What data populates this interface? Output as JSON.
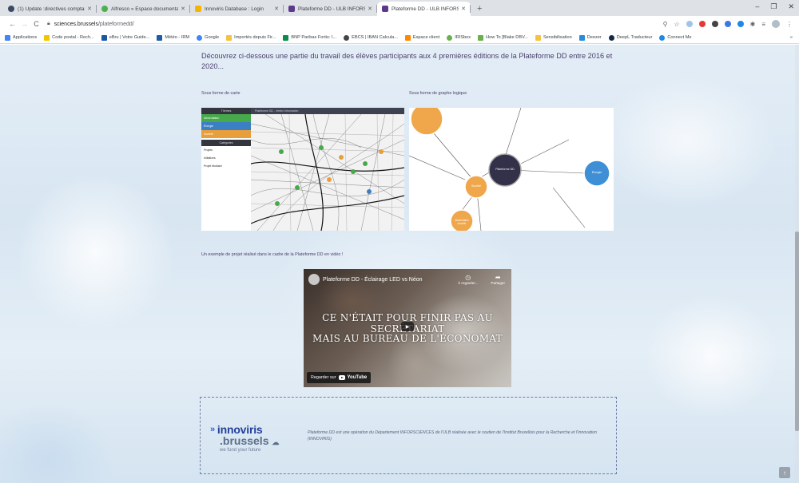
{
  "browser": {
    "tabs": [
      {
        "title": "(1) Update :directives comptables",
        "icon_color": "#3b4a63"
      },
      {
        "title": "Alfresco » Espace documentaire",
        "icon_color": "#4caf50"
      },
      {
        "title": "Innoviris Database : Login",
        "icon_color": "#f5b400"
      },
      {
        "title": "Plateforme DD - ULB INFORSCI",
        "icon_color": "#5b3a8c"
      },
      {
        "title": "Plateforme DD - ULB INFORSCI",
        "icon_color": "#5b3a8c"
      }
    ],
    "new_tab": "+",
    "window_controls": {
      "minimize": "–",
      "restore": "❐",
      "close": "✕"
    },
    "url_host": "sciences.brussels",
    "url_path": "/plateformedd/",
    "nav": {
      "back": "←",
      "forward": "→",
      "reload": "C"
    },
    "bookmarks": [
      {
        "label": "Applications",
        "color": "#4285f4"
      },
      {
        "label": "Code postal - Rech...",
        "color": "#f2c500"
      },
      {
        "label": "eBru | Votre Guide...",
        "color": "#1a56a6"
      },
      {
        "label": "Météo - IRM",
        "color": "#1c5ca8"
      },
      {
        "label": "Google",
        "color": "#4285f4"
      },
      {
        "label": "Importés depuis Fir...",
        "color": "#f5c242"
      },
      {
        "label": "BNP Paribas Fortis: I...",
        "color": "#0a8c4a"
      },
      {
        "label": "EBCS | IBAN Calcula...",
        "color": "#444444"
      },
      {
        "label": "Espace client",
        "color": "#ff8800"
      },
      {
        "label": "IRISbox",
        "color": "#6ab04c"
      },
      {
        "label": "How To [Blake DBV...",
        "color": "#6ab04c"
      },
      {
        "label": "Sensibilisation",
        "color": "#f5c242"
      },
      {
        "label": "Deezer",
        "color": "#2a8bd8"
      },
      {
        "label": "DeepL Traducteur",
        "color": "#0f2b46"
      },
      {
        "label": "Connect Me",
        "color": "#1e88e5"
      }
    ],
    "bookmarks_more": "»"
  },
  "page": {
    "intro": "Découvrez ci-dessous une partie du travail des élèves participants aux 4 premières éditions de la Plateforme DD entre 2016 et 2020...",
    "map_label": "Sous forme de carte",
    "graph_label": "Sous forme de graphe logique",
    "map_screenshot": {
      "header": "Thèmes",
      "topbar": "Plateforme DD - Vertex Information",
      "themes": [
        {
          "label": "Alimentation",
          "color": "#46a94a"
        },
        {
          "label": "Énergie",
          "color": "#3b7fc4"
        },
        {
          "label": "Société",
          "color": "#e89e3a"
        }
      ],
      "categories_header": "Catégories",
      "categories": [
        "Projets",
        "Initiatives",
        "Projet étudiant"
      ]
    },
    "graph_screenshot": {
      "center_node": "Plateforme DD",
      "nodes": [
        "Énergie",
        "Société",
        "Alimentation durable"
      ]
    },
    "video_label": "Un exemple de projet réalisé dans le cadre de la Plateforme DD en vidéo !",
    "video": {
      "title": "Plateforme DD - Éclairage LED vs Néon",
      "watch_later": "À regarder...",
      "share": "Partager",
      "caption_line1": "CE N'ÉTAIT POUR FINIR PAS AU SECRÉTARIAT",
      "caption_line2": "MAIS AU BUREAU DE L'ÉCONOMAT",
      "watch_on": "Regarder sur",
      "youtube": "YouTube"
    },
    "footer": {
      "logo_line1": "innoviris",
      "logo_line2": ".brussels",
      "logo_tagline": "we fund your future",
      "note": "Plateforme DD est une opération du Département INFORSCIENCES de l'ULB réalisée avec le soutien de l'Institut Bruxellois pour la Recherche et l'Innovation (INNOVIRIS)"
    },
    "back_to_top": "↑"
  }
}
